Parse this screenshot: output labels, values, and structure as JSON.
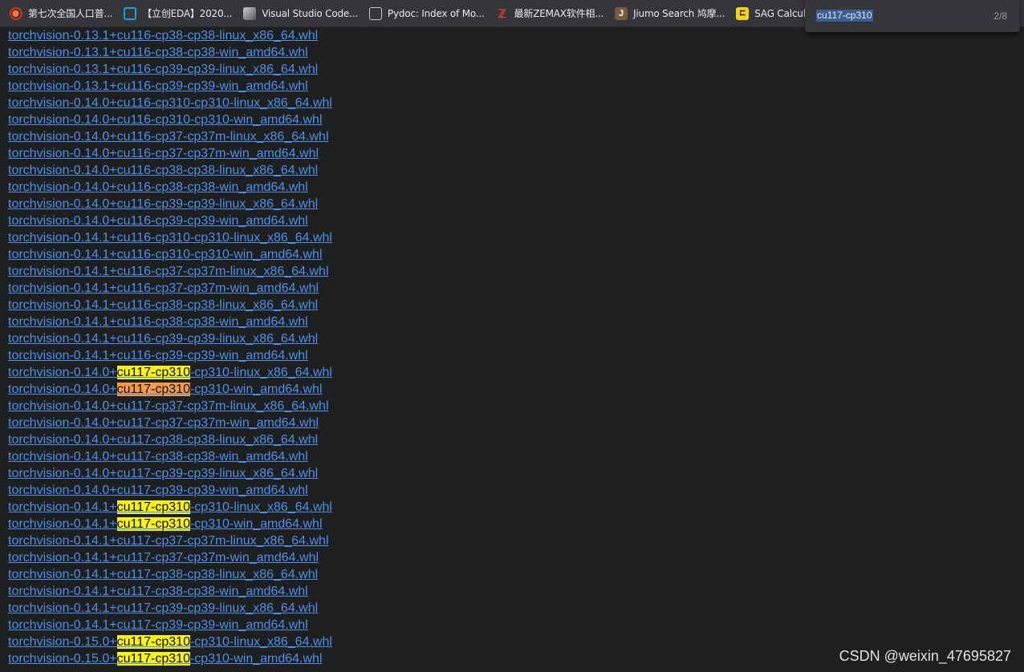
{
  "bookmarks": [
    {
      "label": "第七次全国人口普...",
      "icon": "red-flower-icon"
    },
    {
      "label": "【立创EDA】2020...",
      "icon": "bilibili-tv-icon"
    },
    {
      "label": "Visual Studio Code...",
      "icon": "vscode-thumbnail-icon"
    },
    {
      "label": "Pydoc: Index of Mo...",
      "icon": "document-icon"
    },
    {
      "label": "最新ZEMAX软件相...",
      "icon": "zemax-icon"
    },
    {
      "label": "Jiumo Search 鸠摩...",
      "icon": "jiumo-j-icon"
    },
    {
      "label": "SAG Calculator",
      "icon": "sag-calculator-icon"
    }
  ],
  "find": {
    "query": "cu117-cp310",
    "count": "2/8"
  },
  "links": [
    {
      "pre": "torchvision-0.13.1+cu116-cp38-cp38-linux_x86_64.whl"
    },
    {
      "pre": "torchvision-0.13.1+cu116-cp38-cp38-win_amd64.whl"
    },
    {
      "pre": "torchvision-0.13.1+cu116-cp39-cp39-linux_x86_64.whl"
    },
    {
      "pre": "torchvision-0.13.1+cu116-cp39-cp39-win_amd64.whl"
    },
    {
      "pre": "torchvision-0.14.0+cu116-cp310-cp310-linux_x86_64.whl"
    },
    {
      "pre": "torchvision-0.14.0+cu116-cp310-cp310-win_amd64.whl"
    },
    {
      "pre": "torchvision-0.14.0+cu116-cp37-cp37m-linux_x86_64.whl"
    },
    {
      "pre": "torchvision-0.14.0+cu116-cp37-cp37m-win_amd64.whl"
    },
    {
      "pre": "torchvision-0.14.0+cu116-cp38-cp38-linux_x86_64.whl"
    },
    {
      "pre": "torchvision-0.14.0+cu116-cp38-cp38-win_amd64.whl"
    },
    {
      "pre": "torchvision-0.14.0+cu116-cp39-cp39-linux_x86_64.whl"
    },
    {
      "pre": "torchvision-0.14.0+cu116-cp39-cp39-win_amd64.whl"
    },
    {
      "pre": "torchvision-0.14.1+cu116-cp310-cp310-linux_x86_64.whl"
    },
    {
      "pre": "torchvision-0.14.1+cu116-cp310-cp310-win_amd64.whl"
    },
    {
      "pre": "torchvision-0.14.1+cu116-cp37-cp37m-linux_x86_64.whl"
    },
    {
      "pre": "torchvision-0.14.1+cu116-cp37-cp37m-win_amd64.whl"
    },
    {
      "pre": "torchvision-0.14.1+cu116-cp38-cp38-linux_x86_64.whl"
    },
    {
      "pre": "torchvision-0.14.1+cu116-cp38-cp38-win_amd64.whl"
    },
    {
      "pre": "torchvision-0.14.1+cu116-cp39-cp39-linux_x86_64.whl"
    },
    {
      "pre": "torchvision-0.14.1+cu116-cp39-cp39-win_amd64.whl"
    },
    {
      "pre": "torchvision-0.14.0+",
      "match": "cu117-cp310",
      "post": "-cp310-linux_x86_64.whl"
    },
    {
      "pre": "torchvision-0.14.0+",
      "match": "cu117-cp310",
      "post": "-cp310-win_amd64.whl",
      "active": true
    },
    {
      "pre": "torchvision-0.14.0+cu117-cp37-cp37m-linux_x86_64.whl"
    },
    {
      "pre": "torchvision-0.14.0+cu117-cp37-cp37m-win_amd64.whl"
    },
    {
      "pre": "torchvision-0.14.0+cu117-cp38-cp38-linux_x86_64.whl"
    },
    {
      "pre": "torchvision-0.14.0+cu117-cp38-cp38-win_amd64.whl"
    },
    {
      "pre": "torchvision-0.14.0+cu117-cp39-cp39-linux_x86_64.whl"
    },
    {
      "pre": "torchvision-0.14.0+cu117-cp39-cp39-win_amd64.whl"
    },
    {
      "pre": "torchvision-0.14.1+",
      "match": "cu117-cp310",
      "post": "-cp310-linux_x86_64.whl"
    },
    {
      "pre": "torchvision-0.14.1+",
      "match": "cu117-cp310",
      "post": "-cp310-win_amd64.whl"
    },
    {
      "pre": "torchvision-0.14.1+cu117-cp37-cp37m-linux_x86_64.whl"
    },
    {
      "pre": "torchvision-0.14.1+cu117-cp37-cp37m-win_amd64.whl"
    },
    {
      "pre": "torchvision-0.14.1+cu117-cp38-cp38-linux_x86_64.whl"
    },
    {
      "pre": "torchvision-0.14.1+cu117-cp38-cp38-win_amd64.whl"
    },
    {
      "pre": "torchvision-0.14.1+cu117-cp39-cp39-linux_x86_64.whl"
    },
    {
      "pre": "torchvision-0.14.1+cu117-cp39-cp39-win_amd64.whl"
    },
    {
      "pre": "torchvision-0.15.0+",
      "match": "cu117-cp310",
      "post": "-cp310-linux_x86_64.whl"
    },
    {
      "pre": "torchvision-0.15.0+",
      "match": "cu117-cp310",
      "post": "-cp310-win_amd64.whl"
    }
  ],
  "watermark": "CSDN @weixin_47695827",
  "colors": {
    "link": "#4f8fe8",
    "match": "#f8f31a",
    "active_match": "#f29a4a",
    "background": "#1d1f20"
  }
}
